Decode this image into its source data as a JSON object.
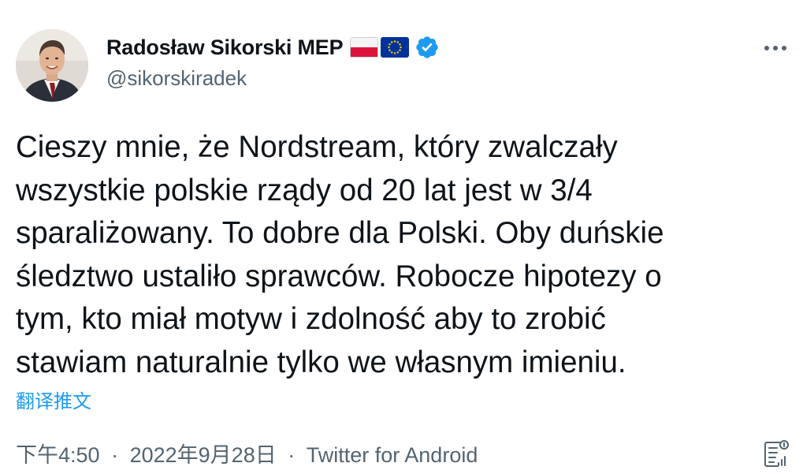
{
  "author": {
    "display_name": "Radosław Sikorski MEP",
    "handle": "@sikorskiradek",
    "flag_1": "poland-flag-icon",
    "flag_2": "eu-flag-icon",
    "verified_icon": "verified-badge-icon"
  },
  "more_menu_icon": "more-options-icon",
  "tweet": {
    "text": "Cieszy mnie, że Nordstream, który zwalczały\nwszystkie polskie rządy od 20 lat jest w 3/4\nsparaliżowany. To dobre dla Polski. Oby duńskie\nśledztwo ustaliło sprawców. Robocze hipotezy o\ntym, kto miał motyw i zdolność aby to zrobić\nstawiam naturalnie tylko we własnym imieniu.",
    "translate_label": "翻译推文"
  },
  "meta": {
    "time": "下午4:50",
    "separator": "·",
    "date": "2022年9月28日",
    "source": "Twitter for Android",
    "analytics_icon": "analytics-icon"
  },
  "colors": {
    "text_primary": "#0f1419",
    "text_secondary": "#536471",
    "link": "#1d9bf0",
    "verified": "#1d9bf0",
    "poland_red": "#dc143c",
    "eu_blue": "#003399",
    "eu_star": "#ffcc00"
  }
}
